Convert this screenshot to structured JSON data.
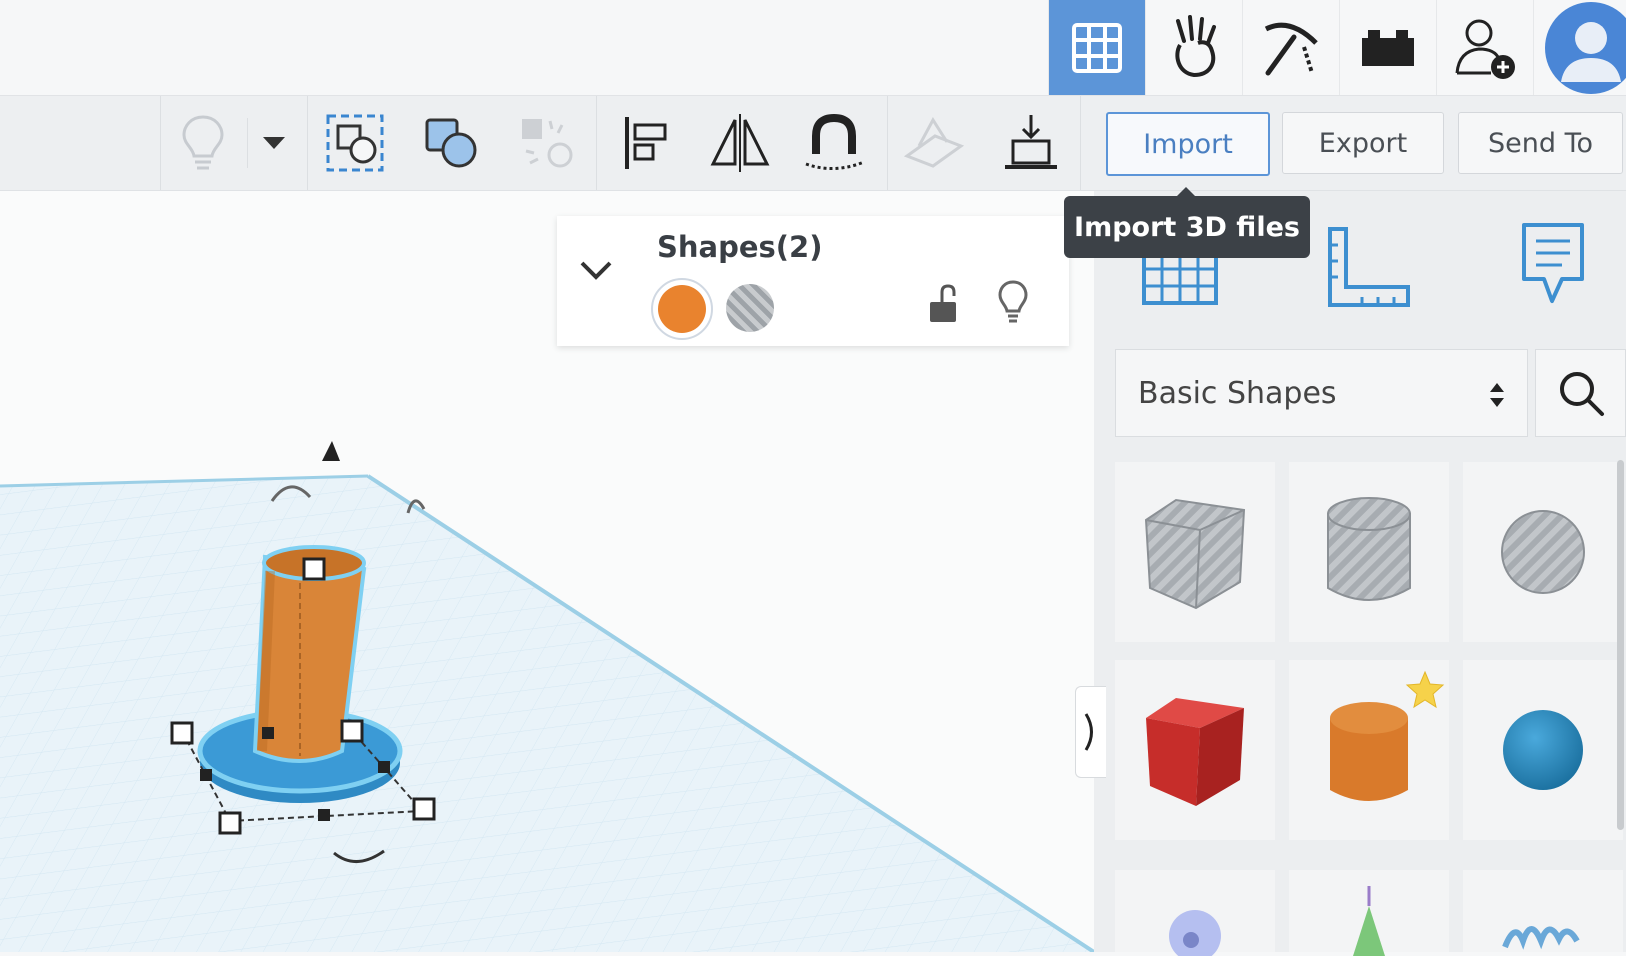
{
  "topbar": {
    "icons": [
      "grid-view-icon",
      "hand-gesture-icon",
      "pickaxe-icon",
      "brick-icon",
      "add-user-icon",
      "user-avatar-icon"
    ]
  },
  "toolbar": {
    "import_label": "Import",
    "export_label": "Export",
    "send_to_label": "Send To",
    "tooltip": "Import 3D files"
  },
  "shapes_panel": {
    "title": "Shapes(2)",
    "colors": [
      "#e9832e",
      "#9ea3a8"
    ]
  },
  "library": {
    "category": "Basic Shapes",
    "shapes": [
      "box-hole",
      "cylinder-hole",
      "sphere-hole",
      "box",
      "cylinder",
      "sphere"
    ]
  },
  "colors": {
    "accent": "#5c95d8",
    "orange": "#e9832e",
    "blue": "#3b95d0",
    "red": "#cc2a2a"
  }
}
